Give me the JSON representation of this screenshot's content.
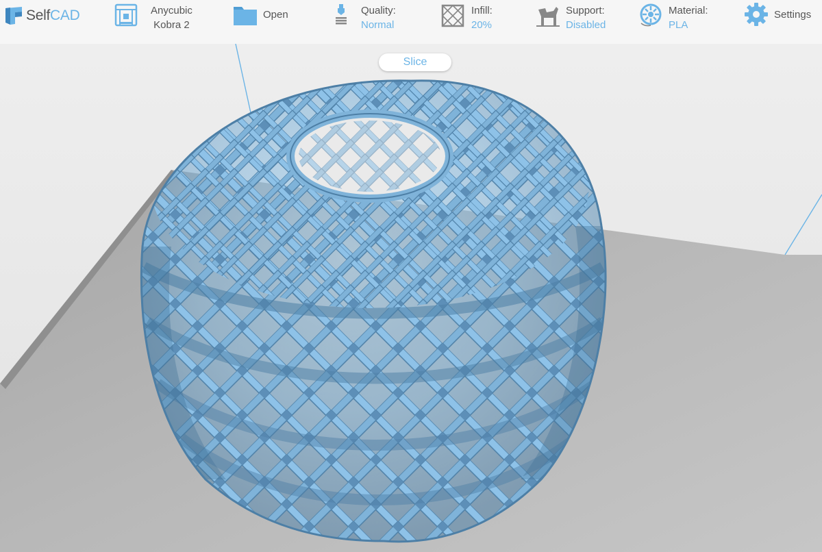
{
  "app": {
    "name_prefix": "Self",
    "name_suffix": "CAD"
  },
  "toolbar": {
    "printer": {
      "line1": "Anycubic",
      "line2": "Kobra 2",
      "icon": "printer-icon"
    },
    "open": {
      "label": "Open",
      "icon": "folder-icon"
    },
    "quality": {
      "label": "Quality:",
      "value": "Normal",
      "icon": "nozzle-icon"
    },
    "infill": {
      "label": "Infill:",
      "value": "20%",
      "icon": "infill-grid-icon"
    },
    "support": {
      "label": "Support:",
      "value": "Disabled",
      "icon": "support-icon"
    },
    "material": {
      "label": "Material:",
      "value": "PLA",
      "icon": "filament-spool-icon"
    },
    "settings": {
      "label": "Settings",
      "icon": "gear-icon"
    }
  },
  "slice": {
    "label": "Slice"
  },
  "colors": {
    "accent": "#6bb4e6",
    "text": "#555555",
    "toolbar_bg": "#f6f6f6",
    "model": "#7fb3d9",
    "model_dark": "#4d7fa6",
    "build_plate": "#b3b3b3"
  }
}
